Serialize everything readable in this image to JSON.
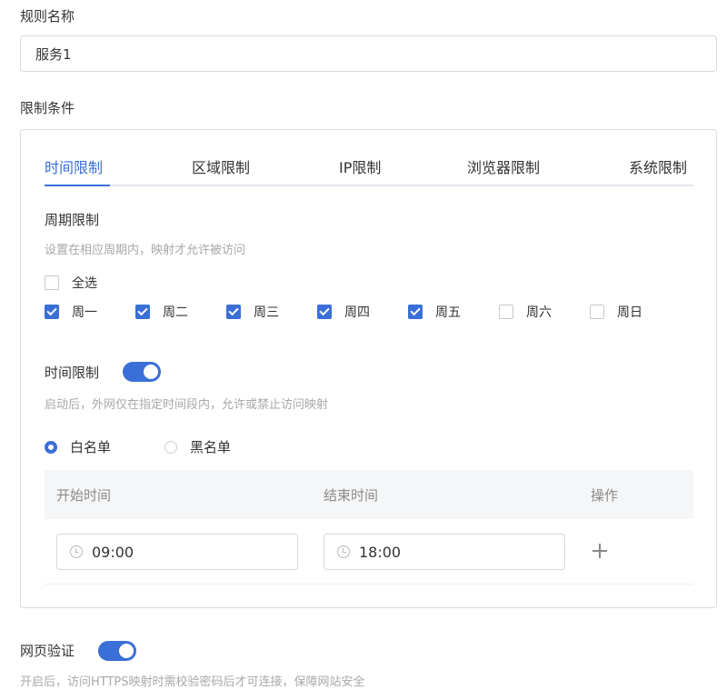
{
  "rule_name": {
    "label": "规则名称",
    "value": "服务1"
  },
  "conditions": {
    "label": "限制条件",
    "tabs": [
      {
        "label": "时间限制",
        "active": true
      },
      {
        "label": "区域限制",
        "active": false
      },
      {
        "label": "IP限制",
        "active": false
      },
      {
        "label": "浏览器限制",
        "active": false
      },
      {
        "label": "系统限制",
        "active": false
      }
    ]
  },
  "period": {
    "title": "周期限制",
    "hint": "设置在相应周期内，映射才允许被访问",
    "select_all": {
      "label": "全选",
      "checked": false
    },
    "days": [
      {
        "label": "周一",
        "checked": true
      },
      {
        "label": "周二",
        "checked": true
      },
      {
        "label": "周三",
        "checked": true
      },
      {
        "label": "周四",
        "checked": true
      },
      {
        "label": "周五",
        "checked": true
      },
      {
        "label": "周六",
        "checked": false
      },
      {
        "label": "周日",
        "checked": false
      }
    ]
  },
  "time_limit": {
    "title": "时间限制",
    "enabled": true,
    "hint": "启动后，外网仅在指定时间段内，允许或禁止访问映射",
    "modes": [
      {
        "label": "白名单",
        "checked": true
      },
      {
        "label": "黑名单",
        "checked": false
      }
    ],
    "table": {
      "columns": [
        "开始时间",
        "结束时间",
        "操作"
      ],
      "rows": [
        {
          "start": "09:00",
          "end": "18:00"
        }
      ]
    }
  },
  "web_auth": {
    "title": "网页验证",
    "enabled": true,
    "hint": "开启后，访问HTTPS映射时需校验密码后才可连接，保障网站安全"
  },
  "colors": {
    "accent": "#3a6fd8",
    "hint_text": "#a8a8a8",
    "border": "#d9d9d9"
  }
}
